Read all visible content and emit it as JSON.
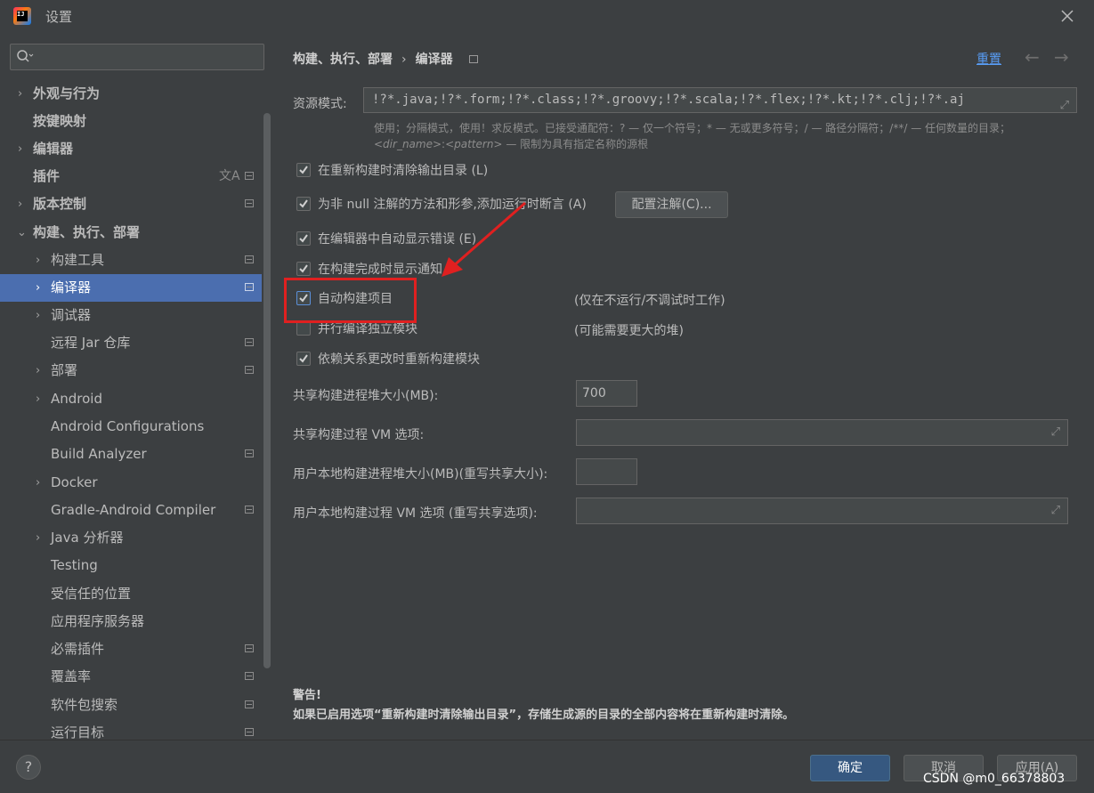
{
  "window": {
    "title": "设置"
  },
  "search": {
    "placeholder": ""
  },
  "sidebar": {
    "items": [
      {
        "label": "外观与行为"
      },
      {
        "label": "按键映射"
      },
      {
        "label": "编辑器"
      },
      {
        "label": "插件"
      },
      {
        "label": "版本控制"
      },
      {
        "label": "构建、执行、部署"
      },
      {
        "label": "构建工具"
      },
      {
        "label": "编译器"
      },
      {
        "label": "调试器"
      },
      {
        "label": "远程 Jar 仓库"
      },
      {
        "label": "部署"
      },
      {
        "label": "Android"
      },
      {
        "label": "Android Configurations"
      },
      {
        "label": "Build Analyzer"
      },
      {
        "label": "Docker"
      },
      {
        "label": "Gradle-Android Compiler"
      },
      {
        "label": "Java 分析器"
      },
      {
        "label": "Testing"
      },
      {
        "label": "受信任的位置"
      },
      {
        "label": "应用程序服务器"
      },
      {
        "label": "必需插件"
      },
      {
        "label": "覆盖率"
      },
      {
        "label": "软件包搜索"
      },
      {
        "label": "运行目标"
      }
    ],
    "selected": "编译器"
  },
  "breadcrumb": {
    "parent": "构建、执行、部署",
    "separator": "›",
    "current": "编译器"
  },
  "header": {
    "reset": "重置",
    "back": "←",
    "forward": "→"
  },
  "resource": {
    "label": "资源模式:",
    "value": "!?*.java;!?*.form;!?*.class;!?*.groovy;!?*.scala;!?*.flex;!?*.kt;!?*.clj;!?*.aj",
    "hint_line1": "使用；分隔模式，使用！求反模式。已接受通配符：? — 仅一个符号；* — 无或更多符号；/ — 路径分隔符；/**/ — 任何数量的目录；",
    "hint_dir": "<dir_name>",
    "hint_colon": ":",
    "hint_pattern": "<pattern>",
    "hint_tail": " — 限制为具有指定名称的源根"
  },
  "options": {
    "clear_output": "在重新构建时清除输出目录 (L)",
    "assertions": "为非 null 注解的方法和形参,添加运行时断言 (A)",
    "configure_annotations": "配置注解(C)...",
    "auto_show_errors": "在编辑器中自动显示错误 (E)",
    "show_notification": "在构建完成时显示通知",
    "auto_build": "自动构建项目",
    "auto_build_note": "(仅在不运行/不调试时工作)",
    "parallel": "并行编译独立模块",
    "parallel_note": "(可能需要更大的堆)",
    "rebuild_deps": "依赖关系更改时重新构建模块"
  },
  "fields": {
    "heap_label": "共享构建进程堆大小(MB):",
    "heap_value": "700",
    "vm_label": "共享构建过程 VM 选项:",
    "user_heap_label": "用户本地构建进程堆大小(MB)(重写共享大小):",
    "user_vm_label": "用户本地构建过程 VM 选项 (重写共享选项):"
  },
  "warning": {
    "title": "警告!",
    "text": "如果已启用选项“重新构建时清除输出目录”，存储生成源的目录的全部内容将在重新构建时清除。"
  },
  "footer": {
    "help": "?",
    "ok": "确定",
    "cancel": "取消",
    "apply": "应用(A)"
  },
  "watermark": "CSDN @m0_66378803",
  "colors": {
    "accent": "#4b6eaf",
    "link": "#589df6",
    "annotation": "#e02020",
    "primary_button": "#365880"
  }
}
